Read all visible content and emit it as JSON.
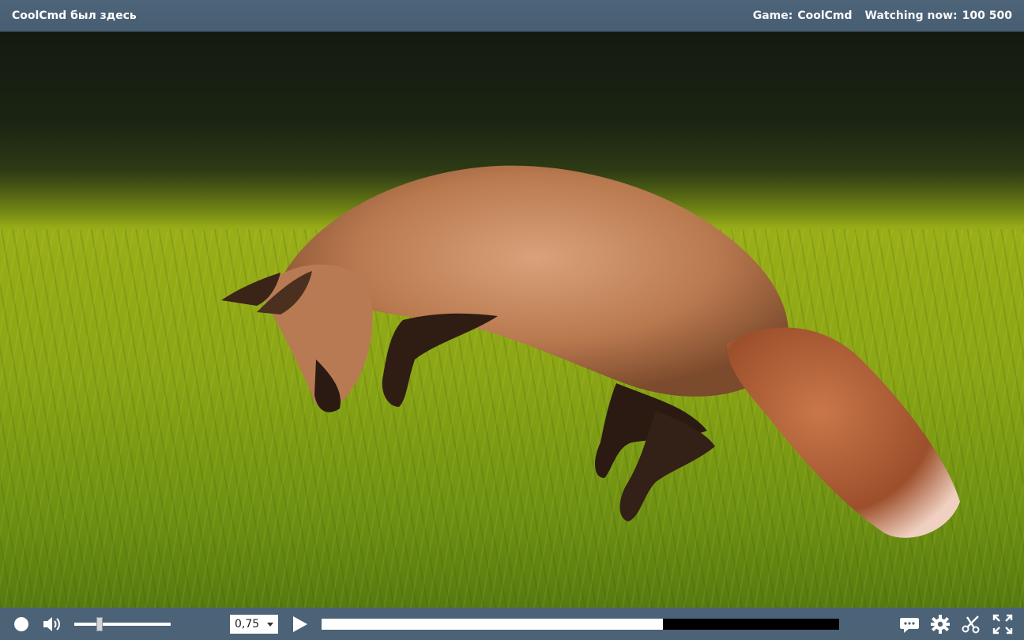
{
  "header": {
    "title": "CoolCmd был здесь",
    "game_label": "Game:",
    "game_value": "CoolCmd",
    "watching_label": "Watching now:",
    "watching_value": "100 500"
  },
  "controls": {
    "speed": {
      "selected": "0,75"
    },
    "volume_level": 0.26,
    "progress_level": 0.66
  },
  "icons": {
    "record": "record-dot-icon",
    "volume": "speaker-icon",
    "play": "play-icon",
    "chat": "chat-bubble-icon",
    "settings": "gear-icon",
    "clip": "scissors-icon",
    "fullscreen": "fullscreen-icon"
  }
}
